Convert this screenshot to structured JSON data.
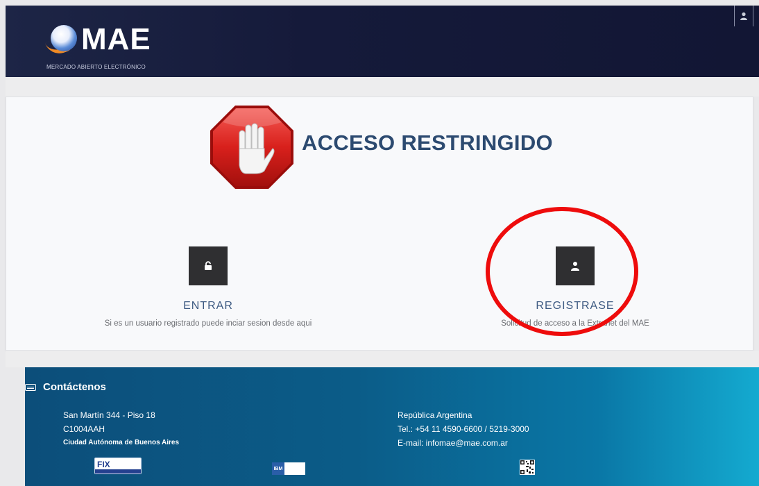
{
  "header": {
    "logo_text": "MAE",
    "logo_subtitle": "MERCADO ABIERTO ELECTRÓNICO",
    "user_icon": "user-icon"
  },
  "main": {
    "stop_icon": "stop-hand-icon",
    "title": "ACCESO RESTRINGIDO",
    "actions": [
      {
        "icon": "unlock-icon",
        "label": "ENTRAR",
        "description": "Si es un usuario registrado puede inciar sesion desde aqui"
      },
      {
        "icon": "user-icon",
        "label": "REGISTRASE",
        "description": "Solicitud de acceso a la Extranet del MAE"
      }
    ],
    "highlight_color": "#ee0c0c"
  },
  "footer": {
    "heading_icon": "keyboard-icon",
    "heading": "Contáctenos",
    "address": {
      "line1": "San Martín 344 - Piso 18",
      "line2": "C1004AAH",
      "line3": "Ciudad Autónoma de Buenos Aires"
    },
    "contact": {
      "country": "República Argentina",
      "phone": "Tel.: +54 11 4590-6600 / 5219-3000",
      "email": "E-mail: infomae@mae.com.ar"
    },
    "badges": [
      {
        "name": "fix-protocol-badge",
        "text": "FIX"
      },
      {
        "name": "ibm-business-partner-badge",
        "text": "IBM"
      },
      {
        "name": "qr-code-badge",
        "text": ""
      }
    ]
  }
}
